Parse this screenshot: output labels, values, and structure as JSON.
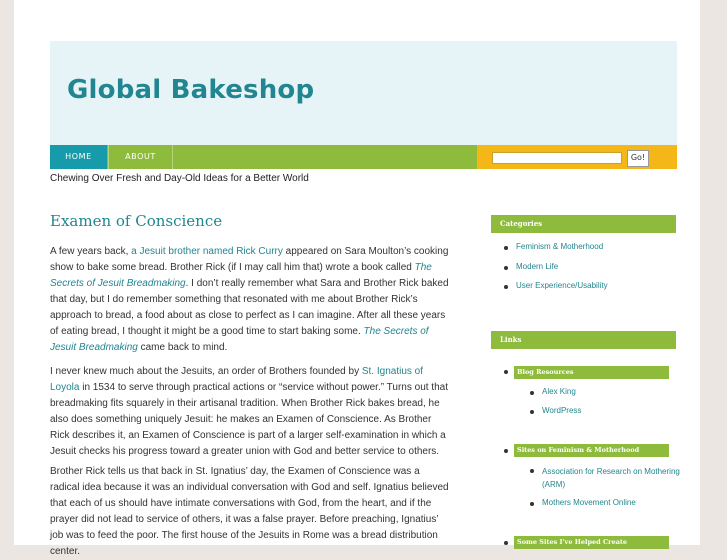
{
  "site": {
    "title": "Global Bakeshop",
    "tagline": "Chewing Over Fresh and Day-Old Ideas for a Better World"
  },
  "nav": {
    "items": [
      {
        "label": "HOME"
      },
      {
        "label": "ABOUT"
      }
    ],
    "search": {
      "placeholder": "",
      "button_label": "Go!"
    }
  },
  "post": {
    "title": "Examen of Conscience",
    "p1": {
      "t1": "A few years back, ",
      "l1": "a Jesuit brother named Rick Curry",
      "t2": " appeared on Sara Moulton’s cooking show to bake some bread. Brother Rick (if I may call him that) wrote a book called ",
      "l2": "The Secrets of Jesuit Breadmaking",
      "t3": ". I don’t really remember what Sara and Brother Rick baked that day, but I do remember something that resonated with me about Brother Rick’s approach to bread, a food about as close to perfect as I can imagine. After all these years of eating bread, I thought it might be a good time to start baking some. ",
      "l3": "The Secrets of Jesuit Breadmaking",
      "t4": " came back to mind."
    },
    "p2": {
      "t1": "I never knew much about the Jesuits, an order of Brothers founded by ",
      "l1": "St. Ignatius of Loyola",
      "t2": " in 1534 to serve through practical actions or “service without power.” Turns out that breadmaking fits squarely in their artisanal tradition. When Brother Rick bakes bread, he also does something uniquely Jesuit: he makes an Examen of Conscience. As Brother Rick describes it, an Examen of Conscience is part of a larger self-examination in which a Jesuit checks his progress toward a greater union with God and better service to others."
    },
    "p3": "Brother Rick tells us that back in St. Ignatius’ day, the Examen of Conscience was a radical idea because it was an individual conversation with God and self. Ignatius believed that each of us should have intimate conversations with God, from the heart, and if the prayer did not lead to service of others, it was a false prayer. Before preaching, Ignatius’ job was to feed the poor. The first house of the Jesuits in Rome was a bread distribution center."
  },
  "sidebar": {
    "categories": {
      "title": "Categories",
      "items": [
        {
          "label": "Feminism & Motherhood"
        },
        {
          "label": "Modern Life"
        },
        {
          "label": "User Experience/Usability"
        }
      ]
    },
    "links": {
      "title": "Links",
      "groups": [
        {
          "title": "Blog Resources",
          "items": [
            {
              "label": "Alex King"
            },
            {
              "label": "WordPress"
            }
          ]
        },
        {
          "title": "Sites on Feminism & Motherhood",
          "items": [
            {
              "label": "Association for Research on Mothering (ARM)"
            },
            {
              "label": "Mothers Movement Online"
            }
          ]
        },
        {
          "title": "Some Sites I've Helped Create",
          "items": []
        }
      ]
    }
  },
  "colors": {
    "accent_teal": "#21868f",
    "nav_green": "#8fbb3c",
    "nav_active": "#179aa9",
    "search_bar": "#f5b718",
    "header_bg": "#e6f4f8"
  }
}
